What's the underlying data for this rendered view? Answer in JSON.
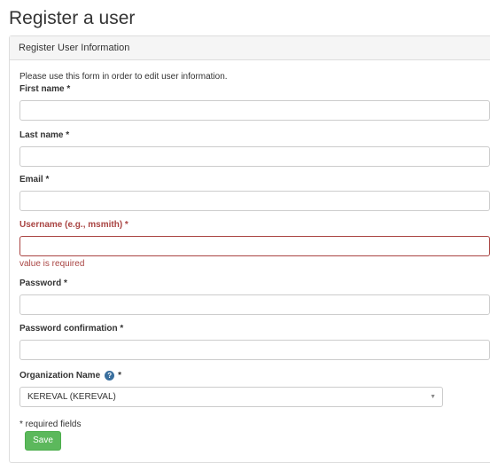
{
  "page": {
    "title": "Register a user"
  },
  "panel": {
    "heading": "Register User Information",
    "intro": "Please use this form in order to edit user information."
  },
  "fields": {
    "first_name": {
      "label": "First name *",
      "value": ""
    },
    "last_name": {
      "label": "Last name *",
      "value": ""
    },
    "email": {
      "label": "Email *",
      "value": ""
    },
    "username": {
      "label": "Username (e.g., msmith) *",
      "value": "",
      "error": "value is required"
    },
    "password": {
      "label": "Password *",
      "value": ""
    },
    "password_confirmation": {
      "label": "Password confirmation *",
      "value": ""
    }
  },
  "organization": {
    "label": "Organization Name",
    "required_marker": "*",
    "selected": "KEREVAL (KEREVAL)"
  },
  "footer": {
    "required_note": "* required fields",
    "save_label": "Save"
  },
  "colors": {
    "error": "#a94442",
    "save": "#5cb85c",
    "help": "#3a6f9e"
  }
}
